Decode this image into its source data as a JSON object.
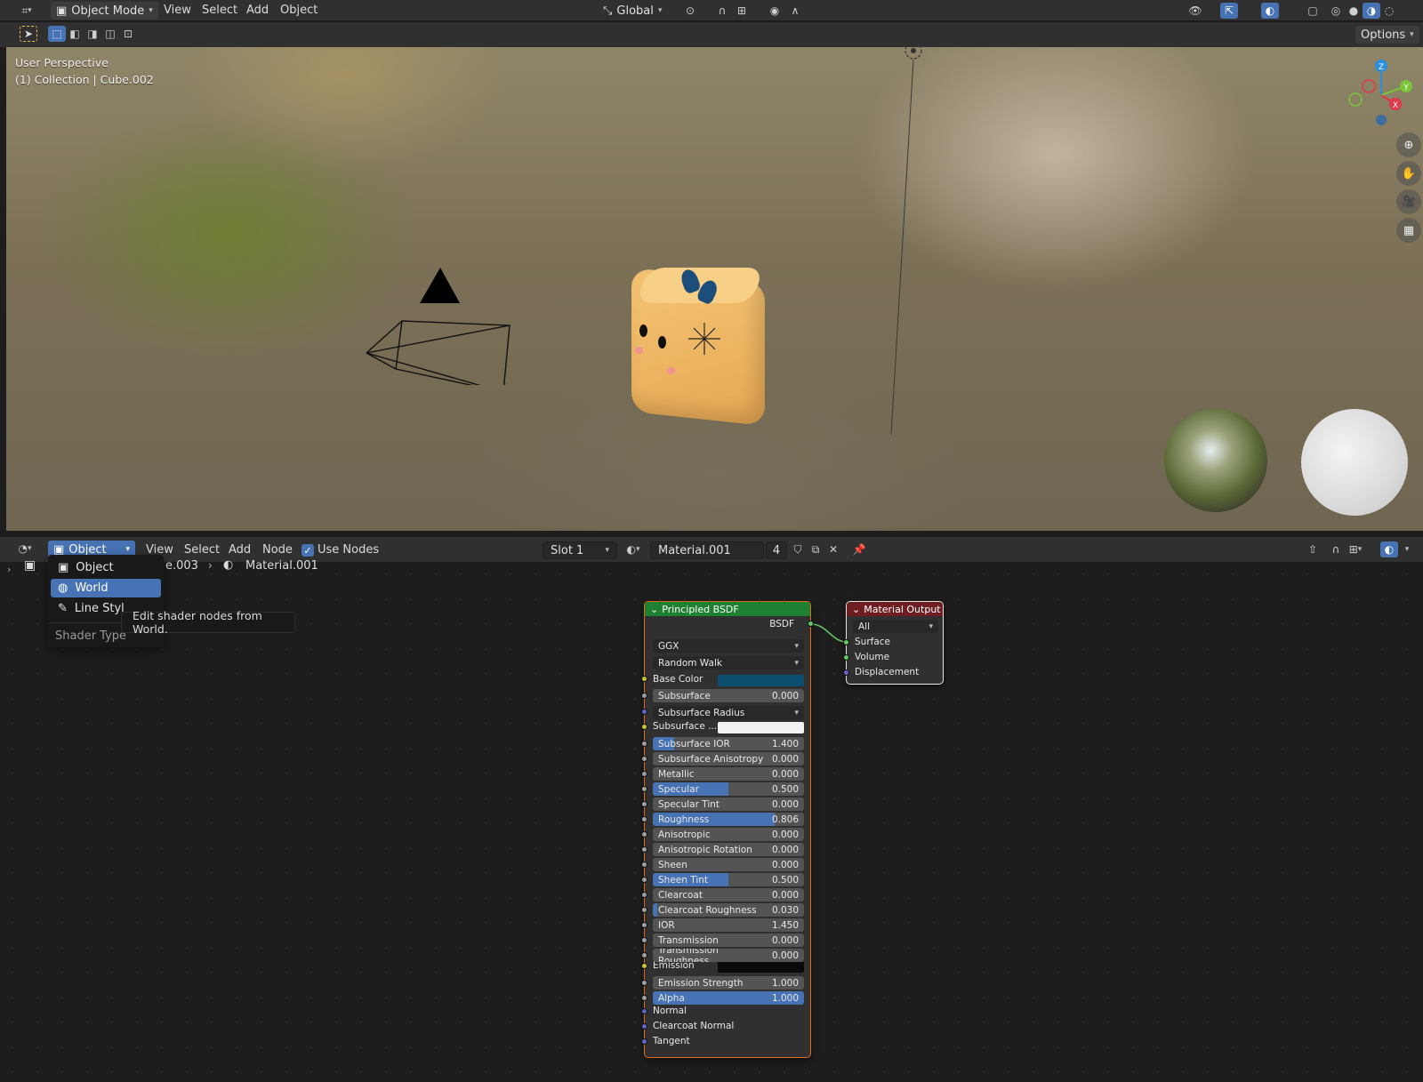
{
  "top_header": {
    "mode_label": "Object Mode",
    "menus": [
      "View",
      "Select",
      "Add",
      "Object"
    ],
    "transform_orientation": "Global",
    "options_label": "Options"
  },
  "viewport": {
    "view_name": "User Perspective",
    "collection_info": "(1) Collection | Cube.002",
    "gizmo_axes": [
      "Z",
      "Y",
      "X"
    ]
  },
  "node_editor": {
    "shader_type_label": "Object",
    "menus": [
      "View",
      "Select",
      "Add",
      "Node"
    ],
    "use_nodes_label": "Use Nodes",
    "use_nodes_checked": true,
    "slot_label": "Slot 1",
    "material_name": "Material.001",
    "material_users": "4",
    "breadcrumb": {
      "object_fragment": "e.003",
      "material": "Material.001"
    }
  },
  "shader_menu": {
    "items": [
      {
        "label": "Object",
        "selected": false
      },
      {
        "label": "World",
        "selected": true
      },
      {
        "label": "Line Styl",
        "selected": false
      }
    ],
    "title": "Shader Type",
    "tooltip": "Edit shader nodes from World."
  },
  "principled_node": {
    "title": "Principled BSDF",
    "output_label": "BSDF",
    "distribution": "GGX",
    "subsurface_method": "Random Walk",
    "base_color_label": "Base Color",
    "base_color": "#0c4d70",
    "subsurface_radius_label": "Subsurface Radius",
    "subsurface_color_label": "Subsurface ...",
    "subsurface_color": "#f2f2f2",
    "emission_label": "Emission",
    "emission_color": "#0a0a0a",
    "params": [
      {
        "label": "Subsurface",
        "value": "0.000",
        "fill": 0.0
      },
      {
        "label": "Subsurface IOR",
        "value": "1.400",
        "fill": 0.14
      },
      {
        "label": "Subsurface Anisotropy",
        "value": "0.000",
        "fill": 0.0
      },
      {
        "label": "Metallic",
        "value": "0.000",
        "fill": 0.0
      },
      {
        "label": "Specular",
        "value": "0.500",
        "fill": 0.5
      },
      {
        "label": "Specular Tint",
        "value": "0.000",
        "fill": 0.0
      },
      {
        "label": "Roughness",
        "value": "0.806",
        "fill": 0.806
      },
      {
        "label": "Anisotropic",
        "value": "0.000",
        "fill": 0.0
      },
      {
        "label": "Anisotropic Rotation",
        "value": "0.000",
        "fill": 0.0
      },
      {
        "label": "Sheen",
        "value": "0.000",
        "fill": 0.0
      },
      {
        "label": "Sheen Tint",
        "value": "0.500",
        "fill": 0.5
      },
      {
        "label": "Clearcoat",
        "value": "0.000",
        "fill": 0.0
      },
      {
        "label": "Clearcoat Roughness",
        "value": "0.030",
        "fill": 0.03
      },
      {
        "label": "IOR",
        "value": "1.450",
        "fill": 0.0
      },
      {
        "label": "Transmission",
        "value": "0.000",
        "fill": 0.0
      },
      {
        "label": "Transmission Roughness",
        "value": "0.000",
        "fill": 0.0
      },
      {
        "label": "Emission Strength",
        "value": "1.000",
        "fill": 0.0
      },
      {
        "label": "Alpha",
        "value": "1.000",
        "fill": 1.0
      }
    ],
    "vector_inputs": [
      "Normal",
      "Clearcoat Normal",
      "Tangent"
    ]
  },
  "output_node": {
    "title": "Material Output",
    "target": "All",
    "inputs": [
      "Surface",
      "Volume",
      "Displacement"
    ]
  }
}
